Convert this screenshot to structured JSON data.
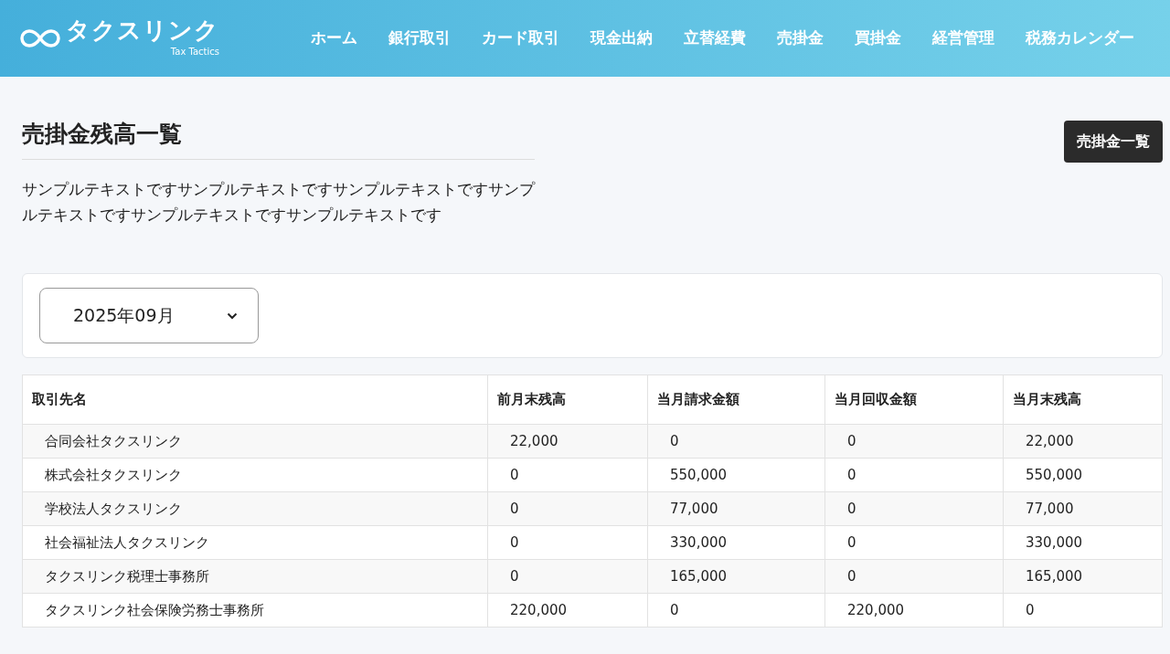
{
  "header": {
    "logo_text": "タクスリンク",
    "logo_subtext": "Tax Tactics",
    "nav": [
      {
        "label": "ホーム"
      },
      {
        "label": "銀行取引"
      },
      {
        "label": "カード取引"
      },
      {
        "label": "現金出納"
      },
      {
        "label": "立替経費"
      },
      {
        "label": "売掛金"
      },
      {
        "label": "買掛金"
      },
      {
        "label": "経営管理"
      },
      {
        "label": "税務カレンダー"
      }
    ]
  },
  "page": {
    "title": "売掛金残高一覧",
    "action_button": "売掛金一覧",
    "description": "サンプルテキストですサンプルテキストですサンプルテキストですサンプルテキストですサンプルテキストですサンプルテキストです"
  },
  "month_select": {
    "value": "2025年09月"
  },
  "table": {
    "columns": [
      "取引先名",
      "前月末残高",
      "当月請求金額",
      "当月回収金額",
      "当月末残高"
    ],
    "rows": [
      [
        "合同会社タクスリンク",
        "22,000",
        "0",
        "0",
        "22,000"
      ],
      [
        "株式会社タクスリンク",
        "0",
        "550,000",
        "0",
        "550,000"
      ],
      [
        "学校法人タクスリンク",
        "0",
        "77,000",
        "0",
        "77,000"
      ],
      [
        "社会福祉法人タクスリンク",
        "0",
        "330,000",
        "0",
        "330,000"
      ],
      [
        "タクスリンク税理士事務所",
        "0",
        "165,000",
        "0",
        "165,000"
      ],
      [
        "タクスリンク社会保険労務士事務所",
        "220,000",
        "0",
        "220,000",
        "0"
      ]
    ]
  }
}
